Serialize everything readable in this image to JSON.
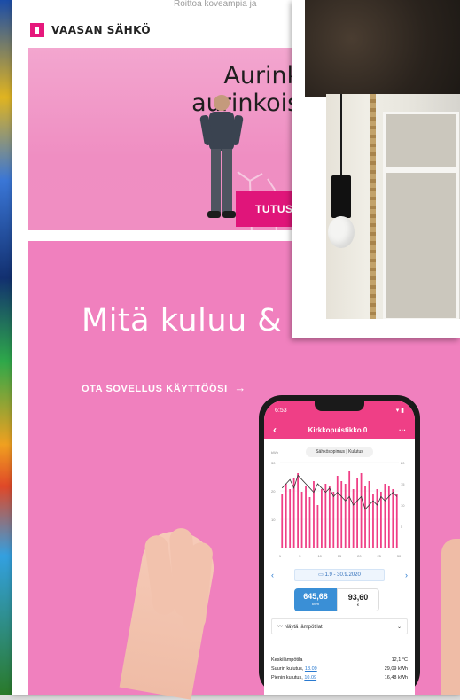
{
  "top_snippet": "Roittoa koveampia ja",
  "brand": {
    "logo_text": "VAASAN SÄHKÖ",
    "accent": "#e6187c"
  },
  "hero": {
    "title_line1": "Aurinkop",
    "title_line2": "aurinkoisim",
    "button_label": "TUTUS"
  },
  "promo": {
    "title": "Mitä kuluu & m",
    "link_label": "OTA SOVELLUS KÄYTTÖÖSI",
    "link_arrow": "→",
    "background": "#f080be"
  },
  "phone_app": {
    "status_time": "6:53",
    "status_icons": "▾ ▮",
    "back_icon": "‹",
    "header_title": "Kirkkopuistikko 0",
    "menu_icon": "···",
    "chart_toggle": "Sähkösopimus | Kulutus",
    "kwh_unit": "kWh",
    "range_prev_icon": "‹",
    "range_label": "1.9 - 30.9.2020",
    "range_next_icon": "›",
    "total_kwh_value": "645,68",
    "total_kwh_unit": "kWh",
    "total_eur_value": "93,60",
    "total_eur_unit": "€",
    "temp_toggle_label": "Näytä lämpötilat",
    "temp_toggle_icon": "⌄",
    "stats": [
      {
        "label": "Keskilämpötila",
        "link": "",
        "value": "12,1 °C"
      },
      {
        "label": "Suurin kulutus,",
        "link": "18.09",
        "value": "29,09 kWh"
      },
      {
        "label": "Pienin kulutus,",
        "link": "10.09",
        "value": "16,48 kWh"
      }
    ]
  },
  "chart_data": {
    "type": "bar",
    "title": "",
    "xlabel": "",
    "ylabel": "kWh",
    "x_ticks": [
      "1",
      "5",
      "10",
      "15",
      "20",
      "25",
      "30"
    ],
    "y_ticks_left": [
      "30",
      "20",
      "10"
    ],
    "y_ticks_right": [
      "20",
      "15",
      "10",
      "5"
    ],
    "ylim": [
      0,
      32
    ],
    "categories": [
      "1",
      "2",
      "3",
      "4",
      "5",
      "6",
      "7",
      "8",
      "9",
      "10",
      "11",
      "12",
      "13",
      "14",
      "15",
      "16",
      "17",
      "18",
      "19",
      "20",
      "21",
      "22",
      "23",
      "24",
      "25",
      "26",
      "27",
      "28",
      "29",
      "30"
    ],
    "series": [
      {
        "type": "bar",
        "color": "#ef3f86",
        "values": [
          20,
          24,
          22,
          26,
          28,
          21,
          23,
          19,
          25,
          16,
          22,
          24,
          23,
          21,
          27,
          25,
          24,
          29,
          22,
          26,
          28,
          23,
          25,
          20,
          22,
          21,
          24,
          23,
          22,
          20
        ]
      },
      {
        "type": "line",
        "color": "#333333",
        "values": [
          14,
          15,
          16,
          14,
          17,
          16,
          15,
          14,
          13,
          15,
          14,
          13,
          14,
          12,
          13,
          12,
          11,
          12,
          10,
          11,
          12,
          9,
          10,
          11,
          10,
          12,
          11,
          12,
          13,
          12
        ]
      }
    ]
  }
}
